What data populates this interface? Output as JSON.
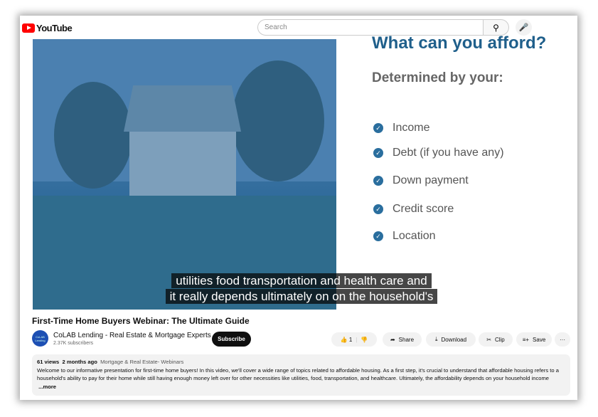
{
  "header": {
    "logo": "YouTube",
    "search_placeholder": "Search",
    "search_icon": "search-icon",
    "mic_icon": "mic-icon"
  },
  "slide": {
    "heading": "What can you afford?",
    "subheading": "Determined by your:",
    "items": [
      "Income",
      "Debt (if you have any)",
      "Down payment",
      "Credit score",
      "Location"
    ],
    "accent": "#1f5f8b"
  },
  "captions": [
    "utilities food transportation and health care and",
    "it really depends ultimately on on the household's"
  ],
  "video": {
    "title": "First-Time Home Buyers Webinar: The Ultimate Guide"
  },
  "channel": {
    "avatar_text": "CoLAB Lending",
    "name": "CoLAB Lending - Real Estate & Mortgage Experts",
    "subscribers": "2.37K subscribers",
    "subscribe": "Subscribe"
  },
  "actions": {
    "likes": "1",
    "share": "Share",
    "download": "Download",
    "clip": "Clip",
    "save": "Save",
    "more": "···"
  },
  "description": {
    "views": "61 views",
    "date": "2 months ago",
    "category": "Mortgage & Real Estate- Webinars",
    "text": "Welcome to our informative presentation for first-time home buyers! In this video, we'll cover a wide range of topics related to affordable housing. As a first step, it's crucial to understand that affordable housing refers to a household's ability to pay for their home while still having enough money left over for other necessities like utilities, food, transportation, and healthcare. Ultimately, the affordability depends on your household income",
    "more": "...more"
  }
}
